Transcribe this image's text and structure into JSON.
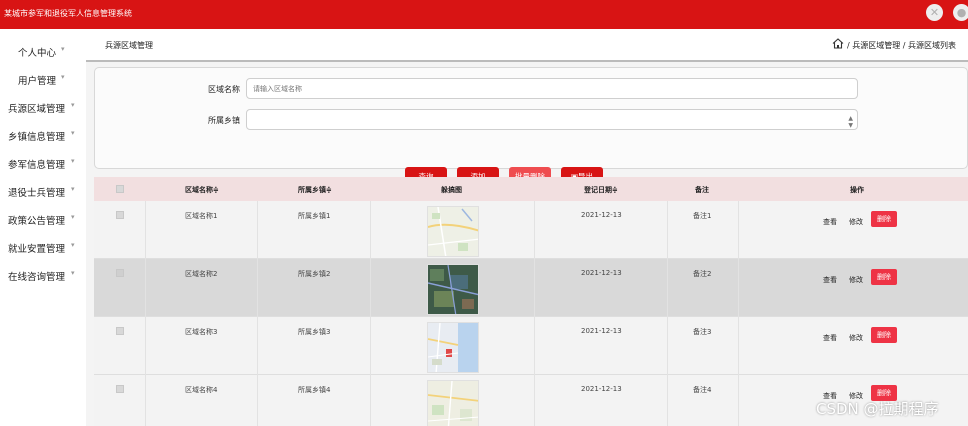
{
  "app": {
    "title": "某城市参军和退役军人信息管理系统"
  },
  "sidebar": {
    "items": [
      {
        "label": "个人中心"
      },
      {
        "label": "用户管理"
      },
      {
        "label": "兵源区域管理"
      },
      {
        "label": "乡镇信息管理"
      },
      {
        "label": "参军信息管理"
      },
      {
        "label": "退役士兵管理"
      },
      {
        "label": "政策公告管理"
      },
      {
        "label": "就业安置管理"
      },
      {
        "label": "在线咨询管理"
      }
    ]
  },
  "header": {
    "page_title": "兵源区域管理",
    "breadcrumb": "/ 兵源区域管理 / 兵源区域列表"
  },
  "search": {
    "name_label": "区域名称",
    "name_placeholder": "请输入区域名称",
    "name_value": "",
    "town_label": "所属乡镇",
    "town_value": "",
    "buttons": {
      "query": "查询",
      "add": "添加",
      "batch_delete": "批量删除",
      "export": "导出"
    }
  },
  "table": {
    "headers": {
      "name": "区域名称",
      "town": "所属乡镇",
      "image": "躲搞图",
      "date": "登记日期",
      "remark": "备注",
      "actions": "操作"
    },
    "action_labels": {
      "view": "查看",
      "edit": "修改",
      "delete": "删除"
    },
    "rows": [
      {
        "name": "区域名称1",
        "town": "所属乡镇1",
        "date": "2021-12-13",
        "remark": "备注1"
      },
      {
        "name": "区域名称2",
        "town": "所属乡镇2",
        "date": "2021-12-13",
        "remark": "备注2"
      },
      {
        "name": "区域名称3",
        "town": "所属乡镇3",
        "date": "2021-12-13",
        "remark": "备注3"
      },
      {
        "name": "区域名称4",
        "town": "所属乡镇4",
        "date": "2021-12-13",
        "remark": "备注4"
      }
    ]
  },
  "watermark": "CSDN @拉期程序",
  "colors": {
    "brand": "#d81414",
    "danger": "#ee3345",
    "header_row": "#f2dfe0"
  }
}
